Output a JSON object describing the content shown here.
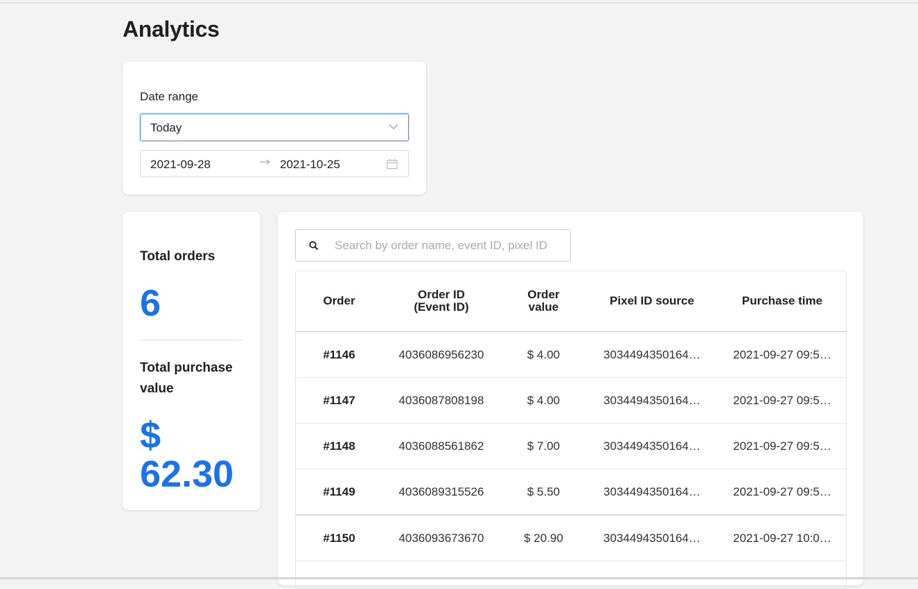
{
  "page": {
    "title": "Analytics"
  },
  "date_filter": {
    "label": "Date range",
    "selected": "Today",
    "start": "2021-09-28",
    "arrow": "→",
    "end": "2021-10-25"
  },
  "stats": {
    "total_orders_label": "Total orders",
    "total_orders_value": "6",
    "total_purchase_label": "Total purchase value",
    "total_purchase_value": "$ 62.30"
  },
  "search": {
    "placeholder": "Search by order name, event ID, pixel ID"
  },
  "table": {
    "columns": [
      "Order",
      "Order ID (Event ID)",
      "Order value",
      "Pixel ID source",
      "Purchase time"
    ],
    "rows": [
      {
        "order": "#1146",
        "order_id": "4036086956230",
        "value": "$ 4.00",
        "pixel": "3034494350164…",
        "time": "2021-09-27 09:5…"
      },
      {
        "order": "#1147",
        "order_id": "4036087808198",
        "value": "$ 4.00",
        "pixel": "3034494350164…",
        "time": "2021-09-27 09:5…"
      },
      {
        "order": "#1148",
        "order_id": "4036088561862",
        "value": "$ 7.00",
        "pixel": "3034494350164…",
        "time": "2021-09-27 09:5…"
      },
      {
        "order": "#1149",
        "order_id": "4036089315526",
        "value": "$ 5.50",
        "pixel": "3034494350164…",
        "time": "2021-09-27 09:5…"
      },
      {
        "order": "#1150",
        "order_id": "4036093673670",
        "value": "$ 20.90",
        "pixel": "3034494350164…",
        "time": "2021-09-27 10:0…"
      }
    ]
  },
  "colors": {
    "accent": "#1a73e8",
    "focus_border": "#4a90d9",
    "background": "#f3f3f3"
  },
  "icons": {
    "select": "chevron-down-icon",
    "date": "calendar-icon",
    "search": "search-icon"
  }
}
